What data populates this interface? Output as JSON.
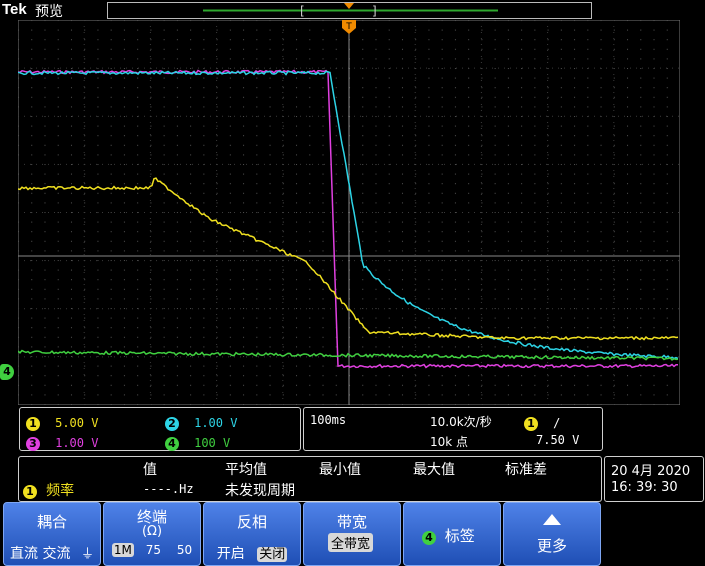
{
  "header": {
    "brand": "Tek",
    "mode": "预览"
  },
  "trigger_marker": "T",
  "channels": [
    {
      "id": "1",
      "scale": "5.00 V",
      "color": "#f0e020"
    },
    {
      "id": "2",
      "scale": "1.00 V",
      "color": "#2dd4e6"
    },
    {
      "id": "3",
      "scale": "1.00 V",
      "color": "#e040e0"
    },
    {
      "id": "4",
      "scale": "100 V",
      "color": "#40d040"
    }
  ],
  "ground_marker": "4",
  "timebase": {
    "scale": "100ms",
    "sample_rate": "10.0k次/秒",
    "record_length": "10k 点",
    "trigger_channel": "1",
    "trigger_slope": "/",
    "trigger_level": "7.50 V"
  },
  "measurement": {
    "headers": [
      "值",
      "平均值",
      "最小值",
      "最大值",
      "标准差"
    ],
    "source": "1",
    "name": "频率",
    "value": "----.Hz",
    "mean": "未发现周期"
  },
  "datetime": {
    "date": "20 4月 2020",
    "time": "16: 39: 30"
  },
  "softkeys": {
    "coupling": {
      "title": "耦合",
      "options": [
        "直流",
        "交流"
      ],
      "icon": "ground"
    },
    "termination": {
      "title": "终端",
      "sub": "(Ω)",
      "options": [
        "1M",
        "75",
        "50"
      ]
    },
    "invert": {
      "title": "反相",
      "options": [
        "开启",
        "关闭"
      ]
    },
    "bandwidth": {
      "title": "带宽",
      "value": "全带宽"
    },
    "label": {
      "channel": "4",
      "title": "标签"
    },
    "more": {
      "title": "更多"
    }
  }
}
